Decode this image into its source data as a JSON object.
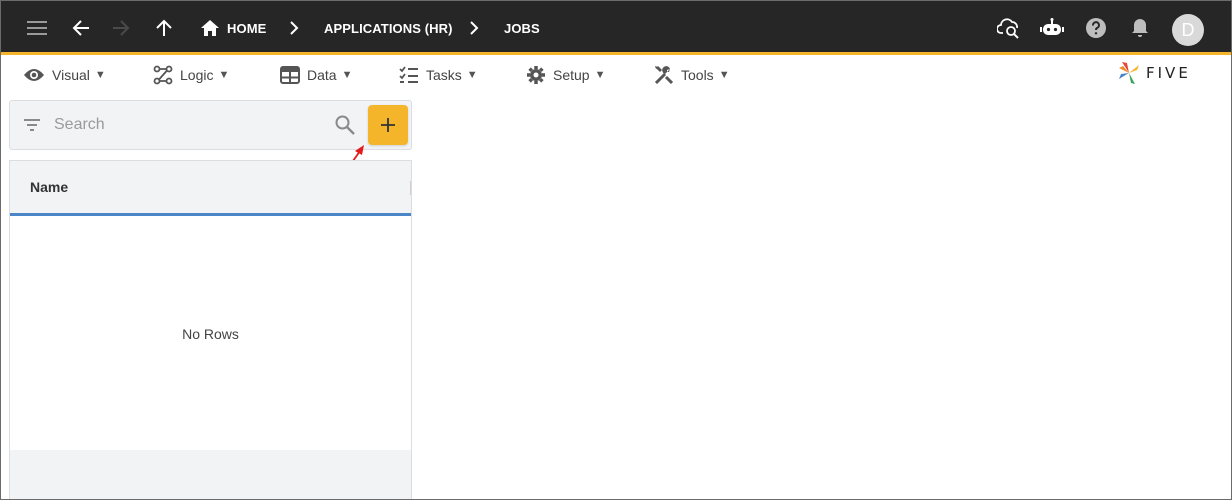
{
  "topbar": {
    "breadcrumbs": [
      {
        "label": "HOME",
        "icon": "home-icon"
      },
      {
        "label": "APPLICATIONS (HR)"
      },
      {
        "label": "JOBS"
      }
    ],
    "icons": [
      "menu-icon",
      "back-icon",
      "forward-icon",
      "up-icon",
      "cloud-search-icon",
      "chat-bot-icon",
      "help-icon",
      "bell-icon"
    ],
    "avatar_initial": "D",
    "accent_color": "#f5b52a",
    "background_color": "#262626"
  },
  "menubar": {
    "items": [
      {
        "label": "Visual",
        "icon": "eye-icon"
      },
      {
        "label": "Logic",
        "icon": "logic-icon"
      },
      {
        "label": "Data",
        "icon": "table-icon"
      },
      {
        "label": "Tasks",
        "icon": "tasks-icon"
      },
      {
        "label": "Setup",
        "icon": "gear-icon"
      },
      {
        "label": "Tools",
        "icon": "tools-icon"
      }
    ],
    "caret": "▼",
    "logo_text": "FIVE"
  },
  "list_panel": {
    "search_placeholder": "Search",
    "search_value": "",
    "add_button_label": "+",
    "add_button_color": "#f5b52a",
    "columns": [
      "Name"
    ],
    "empty_text": "No Rows",
    "header_underline_color": "#4a86c8"
  }
}
